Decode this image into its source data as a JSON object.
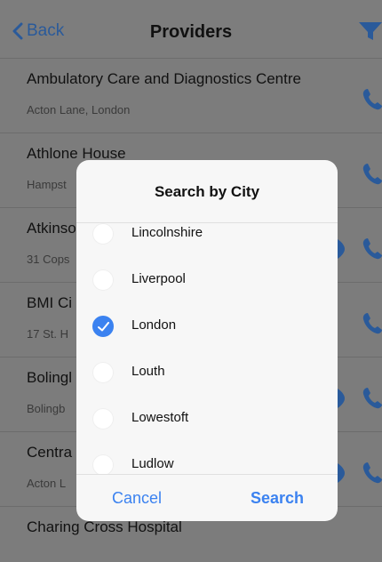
{
  "nav": {
    "back_label": "Back",
    "title": "Providers",
    "filter_icon": "filter-icon",
    "accent": "#2a5a9a"
  },
  "providers": [
    {
      "name": "Ambulatory Care and Diagnostics Centre",
      "address": "Acton Lane, London",
      "has_location": false
    },
    {
      "name": "Athlone House",
      "address": "Hampst",
      "has_location": false
    },
    {
      "name": "Atkinso",
      "address": "31 Cops",
      "has_location": true
    },
    {
      "name": "BMI Ci",
      "address": "17 St. H",
      "has_location": false
    },
    {
      "name": "Bolingl",
      "address": "Bolingb",
      "has_location": true
    },
    {
      "name": "Centra",
      "address": "Acton L",
      "has_location": true
    },
    {
      "name": "Charing Cross Hospital",
      "address": "",
      "has_location": false
    }
  ],
  "modal": {
    "title": "Search by City",
    "cities": [
      {
        "label": "Lincolnshire",
        "selected": false
      },
      {
        "label": "Liverpool",
        "selected": false
      },
      {
        "label": "London",
        "selected": true
      },
      {
        "label": "Louth",
        "selected": false
      },
      {
        "label": "Lowestoft",
        "selected": false
      },
      {
        "label": "Ludlow",
        "selected": false
      }
    ],
    "cancel_label": "Cancel",
    "search_label": "Search",
    "accent": "#3b82f0"
  }
}
